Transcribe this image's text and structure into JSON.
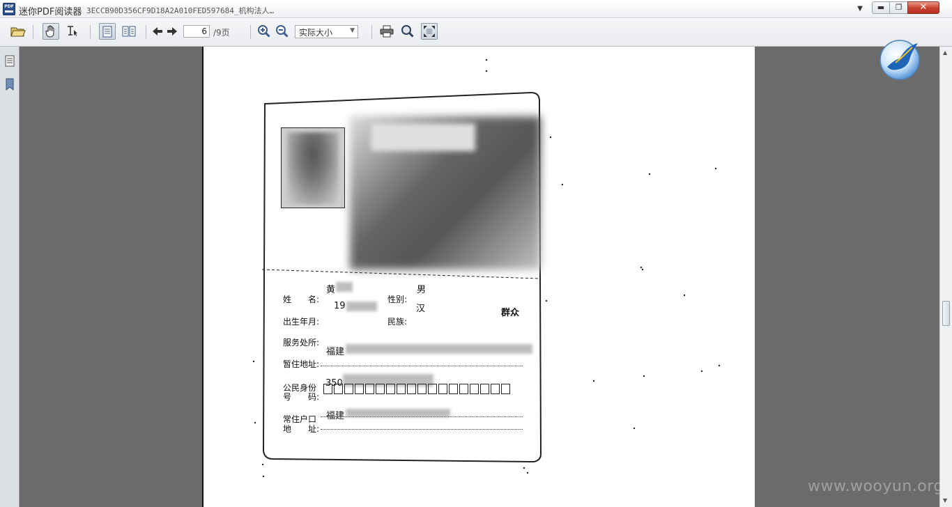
{
  "window": {
    "app_name": "迷你PDF阅读器",
    "doc_title": "3ECCB90D356CF9D18A2A010FED597684_机构法人…",
    "app_icon_text": "PDF",
    "minimize_label": "▬",
    "maximize_label": "❐",
    "close_label": "✕"
  },
  "toolbar": {
    "current_page": "6",
    "page_total": "/9页",
    "zoom_value": "实际大小"
  },
  "document": {
    "fields": {
      "name_label": "姓　　名:",
      "name_value": "黄",
      "gender_label": "性别:",
      "gender_value": "男",
      "birth_label": "出生年月:",
      "birth_value": "19",
      "ethnic_label": "民族:",
      "ethnic_value": "汉",
      "political_value": "群众",
      "work_label": "服务处所:",
      "work_value": "福建",
      "temp_addr_label": "暂住地址:",
      "id_label_1": "公民身份",
      "id_label_2": "号　　码:",
      "id_value": "350",
      "hukou_label_1": "常住户口",
      "hukou_label_2": "地　　址:",
      "hukou_value": "福建"
    }
  },
  "watermark": "www.wooyun.org",
  "colors": {
    "viewer_bg": "#6b6b6b",
    "close_red": "#c6402d",
    "toolbar_icon": "#3a4a63"
  }
}
